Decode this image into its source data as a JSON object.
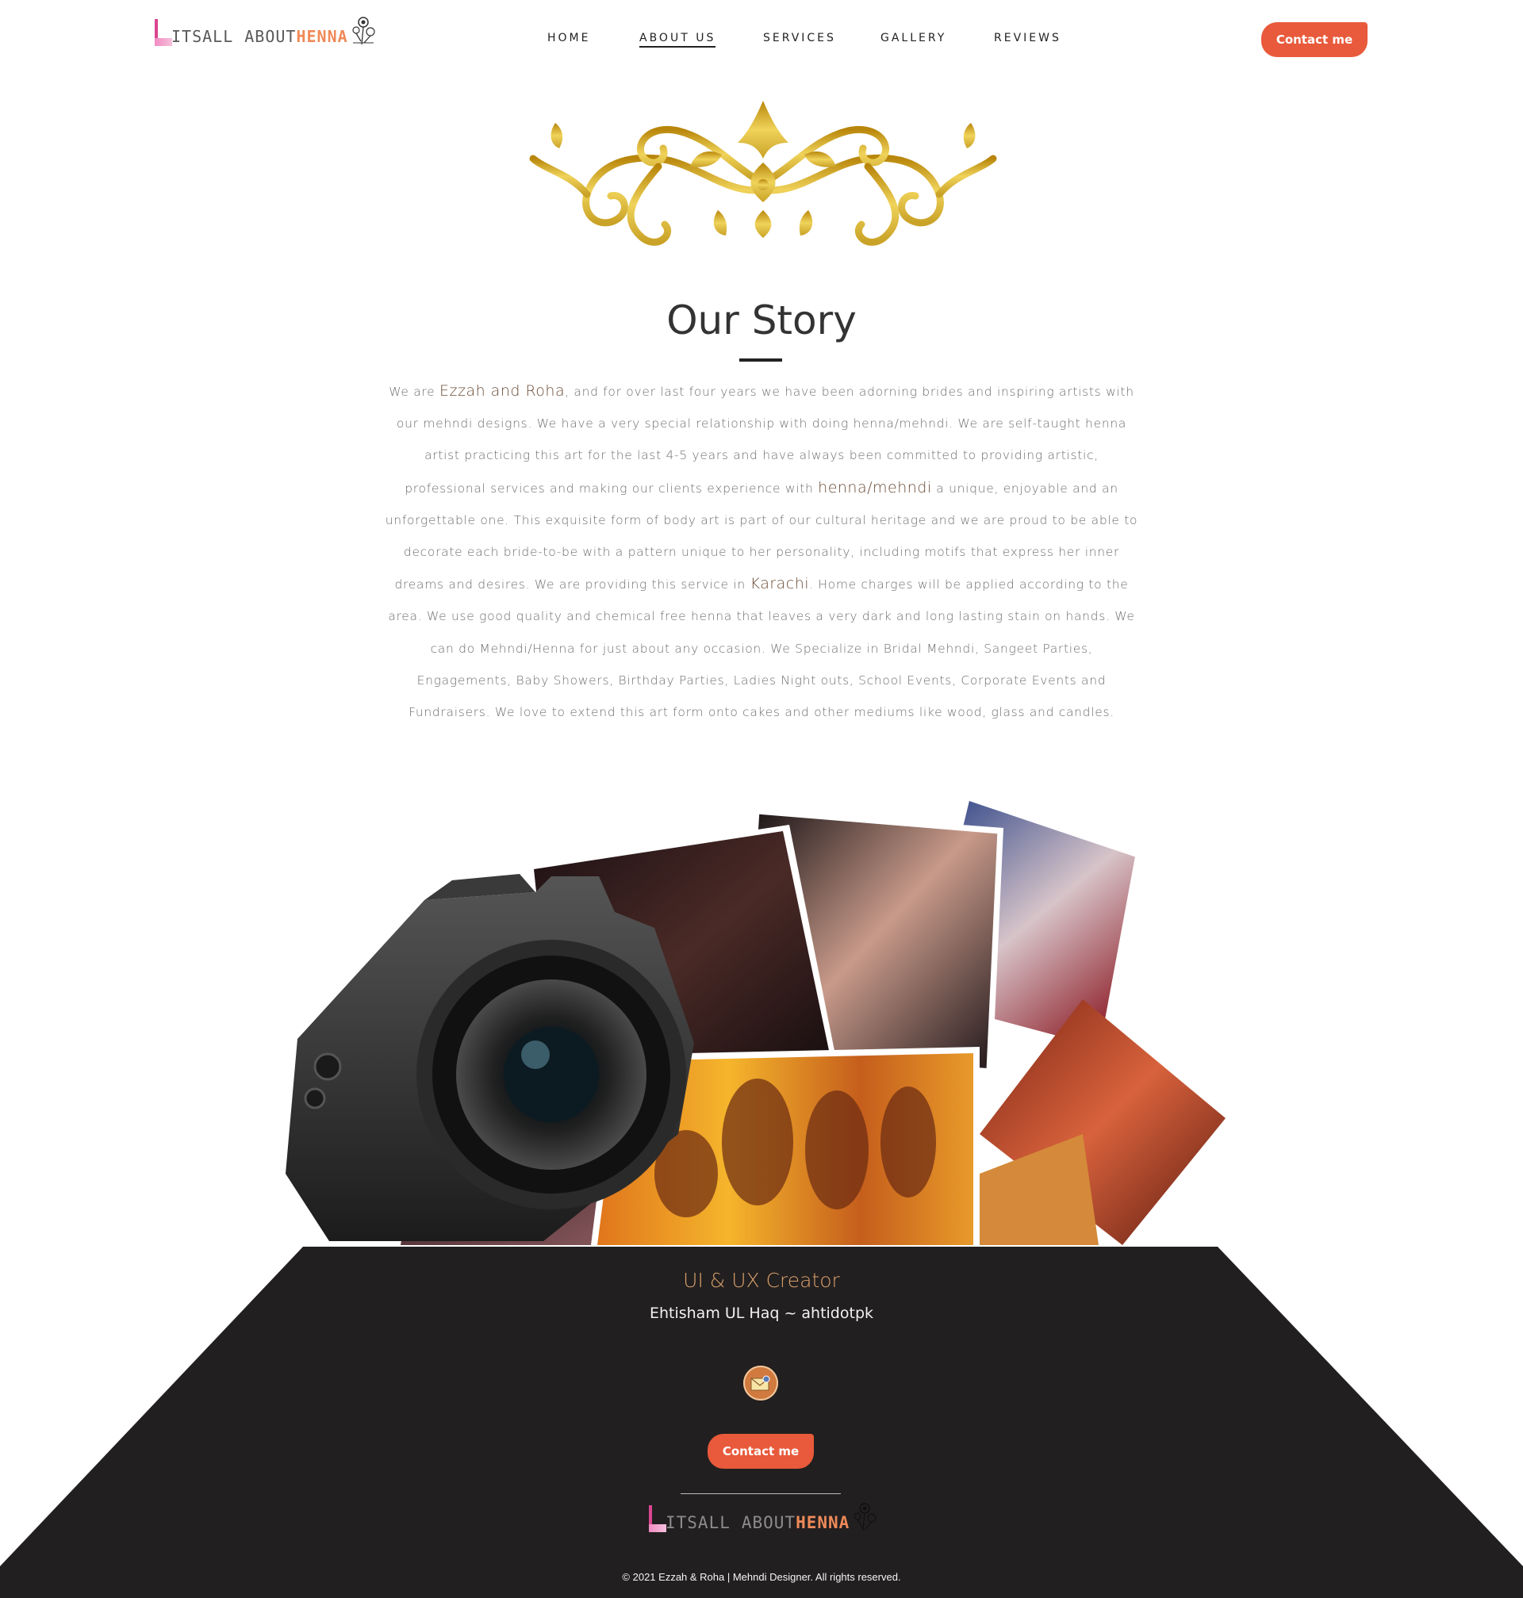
{
  "header": {
    "logo": {
      "part1": "ITSALL",
      "part2": "ABOUT",
      "part3": "HENNA"
    },
    "nav": [
      {
        "label": "HOME",
        "active": false
      },
      {
        "label": "ABOUT US",
        "active": true
      },
      {
        "label": "SERVICES",
        "active": false
      },
      {
        "label": "GALLERY",
        "active": false
      },
      {
        "label": "REVIEWS",
        "active": false
      }
    ],
    "contact_label": "Contact me"
  },
  "story": {
    "title": "Our Story",
    "text_parts": [
      {
        "t": "We are ",
        "hl": false
      },
      {
        "t": "Ezzah and Roha",
        "hl": true
      },
      {
        "t": ", and for over last four years we have been adorning brides and inspiring artists with our mehndi designs. We have a very special relationship with doing henna/mehndi. We are self-taught henna artist practicing this art for the last 4-5 years and have always been committed to providing artistic, professional services and making our clients experience with ",
        "hl": false
      },
      {
        "t": "henna/mehndi",
        "hl": true
      },
      {
        "t": " a unique, enjoyable and an unforgettable one. This exquisite form of body art is part of our cultural heritage and we are proud to be able to decorate each bride-to-be with a pattern unique to her personality, including motifs that express her inner dreams and desires. We are providing this service in ",
        "hl": false
      },
      {
        "t": "Karachi",
        "hl": true
      },
      {
        "t": ". Home charges will be applied according to the area. We use good quality and chemical free henna that leaves a very dark and long lasting stain on hands. We can do Mehndi/Henna for just about any occasion. We Specialize in Bridal Mehndi, Sangeet Parties, Engagements, Baby Showers, Birthday Parties, Ladies Night outs, School Events, Corporate Events and Fundraisers. We love to extend this art form onto cakes and other mediums like wood, glass and candles.",
        "hl": false
      }
    ]
  },
  "collage": {
    "camera_icon": "camera-icon",
    "photos": [
      "henna-hand-photo",
      "henna-hand-photo",
      "henna-hand-photo",
      "henna-hand-photo",
      "henna-hands-group-photo",
      "henna-hand-photo",
      "henna-feet-photo"
    ]
  },
  "footer": {
    "title": "UI & UX Creator",
    "subtitle": "Ehtisham UL Haq ~ ahtidotpk",
    "mail_icon": "mail-icon",
    "contact_label": "Contact me",
    "logo": {
      "part1": "ITSALL",
      "part2": "ABOUT",
      "part3": "HENNA"
    },
    "copyright": "© 2021 Ezzah & Roha | Mehndi Designer. All rights reserved."
  },
  "colors": {
    "accent": "#e85a3b",
    "gold": "#c9a227",
    "footer_bg": "#221f20",
    "footer_title": "#d9a06b",
    "highlight_text": "#6a4b36"
  }
}
